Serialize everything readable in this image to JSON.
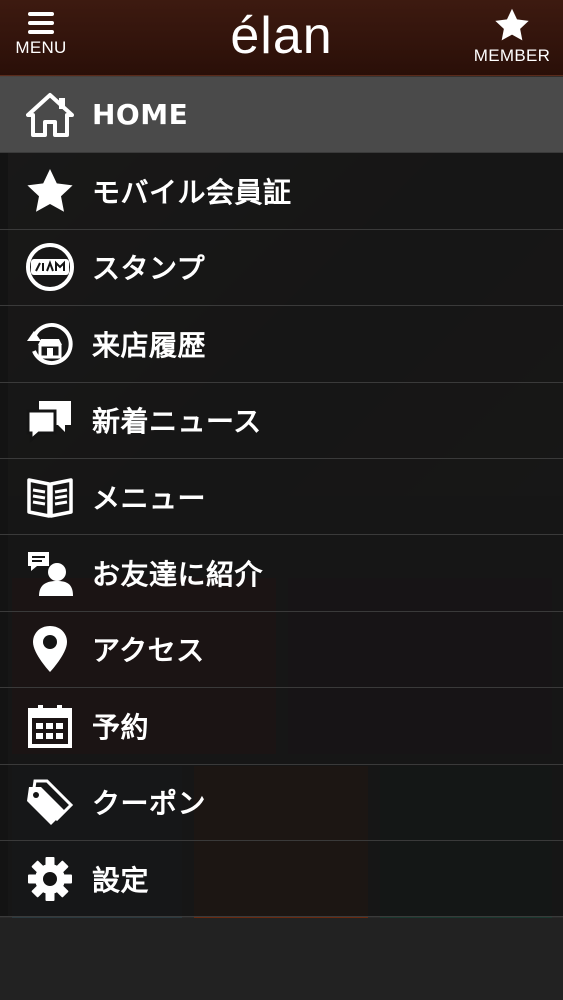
{
  "header": {
    "menu_label": "MENU",
    "logo": "élan",
    "member_label": "MEMBER"
  },
  "drawer": {
    "items": [
      {
        "label": "HOME",
        "icon": "home-icon",
        "active": true
      },
      {
        "label": "モバイル会員証",
        "icon": "star-icon"
      },
      {
        "label": "スタンプ",
        "icon": "stamp-icon"
      },
      {
        "label": "来店履歴",
        "icon": "visit-history-icon"
      },
      {
        "label": "新着ニュース",
        "icon": "news-chat-icon"
      },
      {
        "label": "メニュー",
        "icon": "menu-book-icon"
      },
      {
        "label": "お友達に紹介",
        "icon": "friend-referral-icon"
      },
      {
        "label": "アクセス",
        "icon": "location-pin-icon"
      },
      {
        "label": "予約",
        "icon": "calendar-icon"
      },
      {
        "label": "クーポン",
        "icon": "coupon-tag-icon"
      },
      {
        "label": "設定",
        "icon": "gear-icon"
      }
    ]
  },
  "colors": {
    "header_bg": "#2a0f08",
    "drawer_bg": "#141414",
    "active_item_bg": "#4a4a4a",
    "text": "#ffffff"
  }
}
